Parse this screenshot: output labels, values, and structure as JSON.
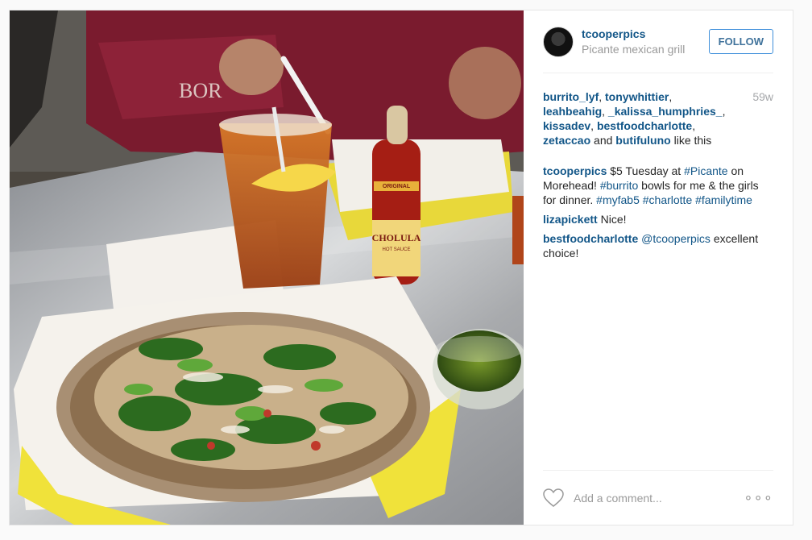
{
  "post": {
    "username": "tcooperpics",
    "location": "Picante mexican grill",
    "follow_label": "FOLLOW",
    "time_ago": "59w",
    "likers": [
      "burrito_lyf",
      "tonywhittier",
      "leahbeahig",
      "_kalissa_humphries_",
      "kissadev",
      "bestfoodcharlotte",
      "zetaccao",
      "butifuluno"
    ],
    "likes_sep": ", ",
    "likes_and": " and ",
    "likes_suffix": " like this",
    "caption": {
      "user": "tcooperpics",
      "parts": [
        {
          "t": "$5 Tuesday at ",
          "tag": false
        },
        {
          "t": "#Picante",
          "tag": true
        },
        {
          "t": " on Morehead! ",
          "tag": false
        },
        {
          "t": "#burrito",
          "tag": true
        },
        {
          "t": " bowls for me & the girls for dinner. ",
          "tag": false
        },
        {
          "t": "#myfab5",
          "tag": true
        },
        {
          "t": " ",
          "tag": false
        },
        {
          "t": "#charlotte",
          "tag": true
        },
        {
          "t": " ",
          "tag": false
        },
        {
          "t": "#familytime",
          "tag": true
        }
      ]
    },
    "comments": [
      {
        "user": "lizapickett",
        "parts": [
          {
            "t": "Nice!",
            "tag": false
          }
        ]
      },
      {
        "user": "bestfoodcharlotte",
        "parts": [
          {
            "t": "@tcooperpics",
            "tag": true
          },
          {
            "t": " excellent choice!",
            "tag": false
          }
        ]
      }
    ],
    "add_comment_placeholder": "Add a comment...",
    "more_glyph": "∘∘∘",
    "hot_sauce_label": "CHOLULA",
    "hot_sauce_sub": "HOT SAUCE",
    "hot_sauce_top": "ORIGINAL"
  }
}
